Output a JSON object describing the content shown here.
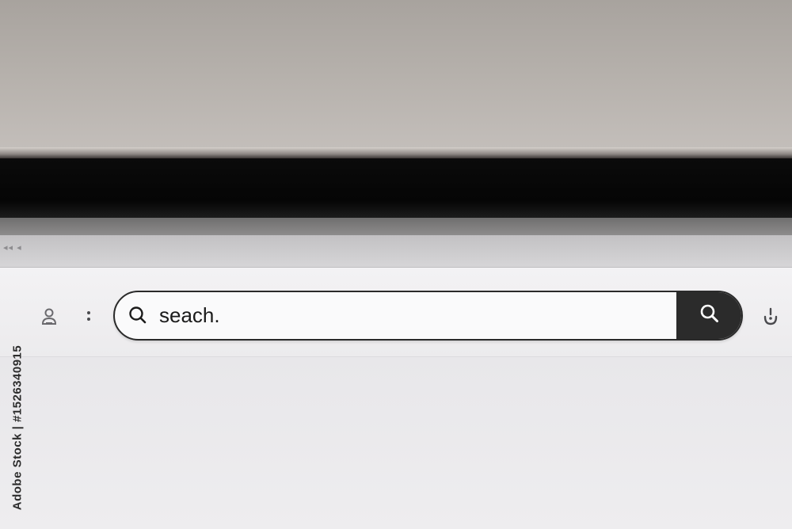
{
  "search": {
    "value": "seach.",
    "search_icon": "search-icon",
    "submit_icon": "magnifier-icon"
  },
  "toolbar": {
    "left_icon": "user-badge-icon",
    "menu_icon": "vertical-dots-icon",
    "right_icon": "assistant-icon"
  },
  "watermark": {
    "text": "Adobe Stock | #1526340915"
  },
  "colors": {
    "search_button": "#2b2b2b",
    "bezel": "#050505",
    "wall": "#b7b2ad"
  }
}
